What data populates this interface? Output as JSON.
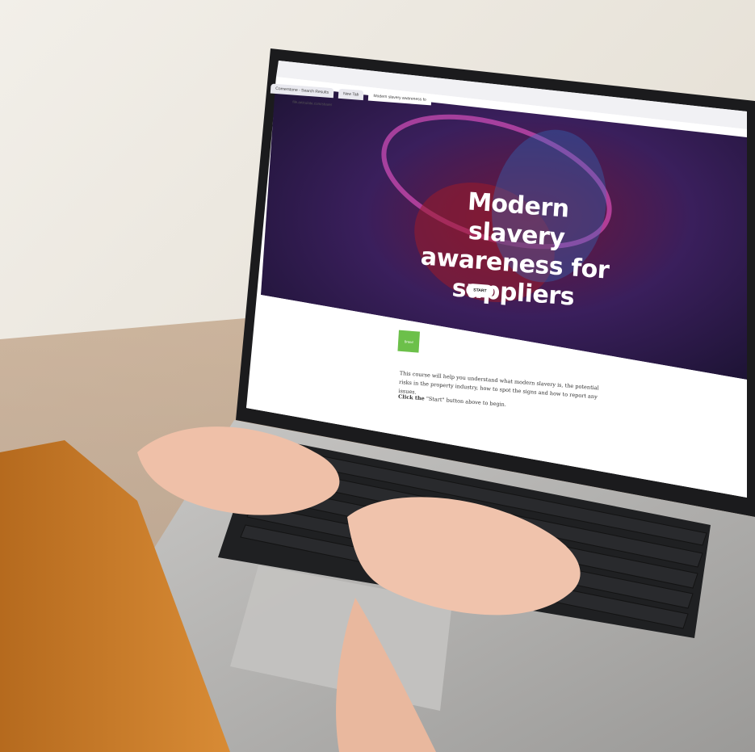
{
  "browser": {
    "tabs": [
      "Cornerstone - Search Results",
      "New Tab",
      "Modern slavery awareness fo"
    ],
    "url": "file.articulate.com/share/"
  },
  "course": {
    "title_line1": "Modern slavery",
    "title_line2": "awareness for",
    "title_line3": "suppliers",
    "start_label": "START",
    "logo_text": "Brand",
    "description": "This course will help you understand what modern slavery is, the potential risks in the property industry, how to spot the signs and how to report any issues.",
    "cta_bold": "Click the",
    "cta_rest": "\"Start\" button above to begin."
  },
  "colors": {
    "page_bg": "#1e1b4b",
    "hero_dark": "#241436",
    "hero_magenta": "#6b163c",
    "hero_blue": "#2a3a7a",
    "accent_green": "#6cc04a"
  }
}
